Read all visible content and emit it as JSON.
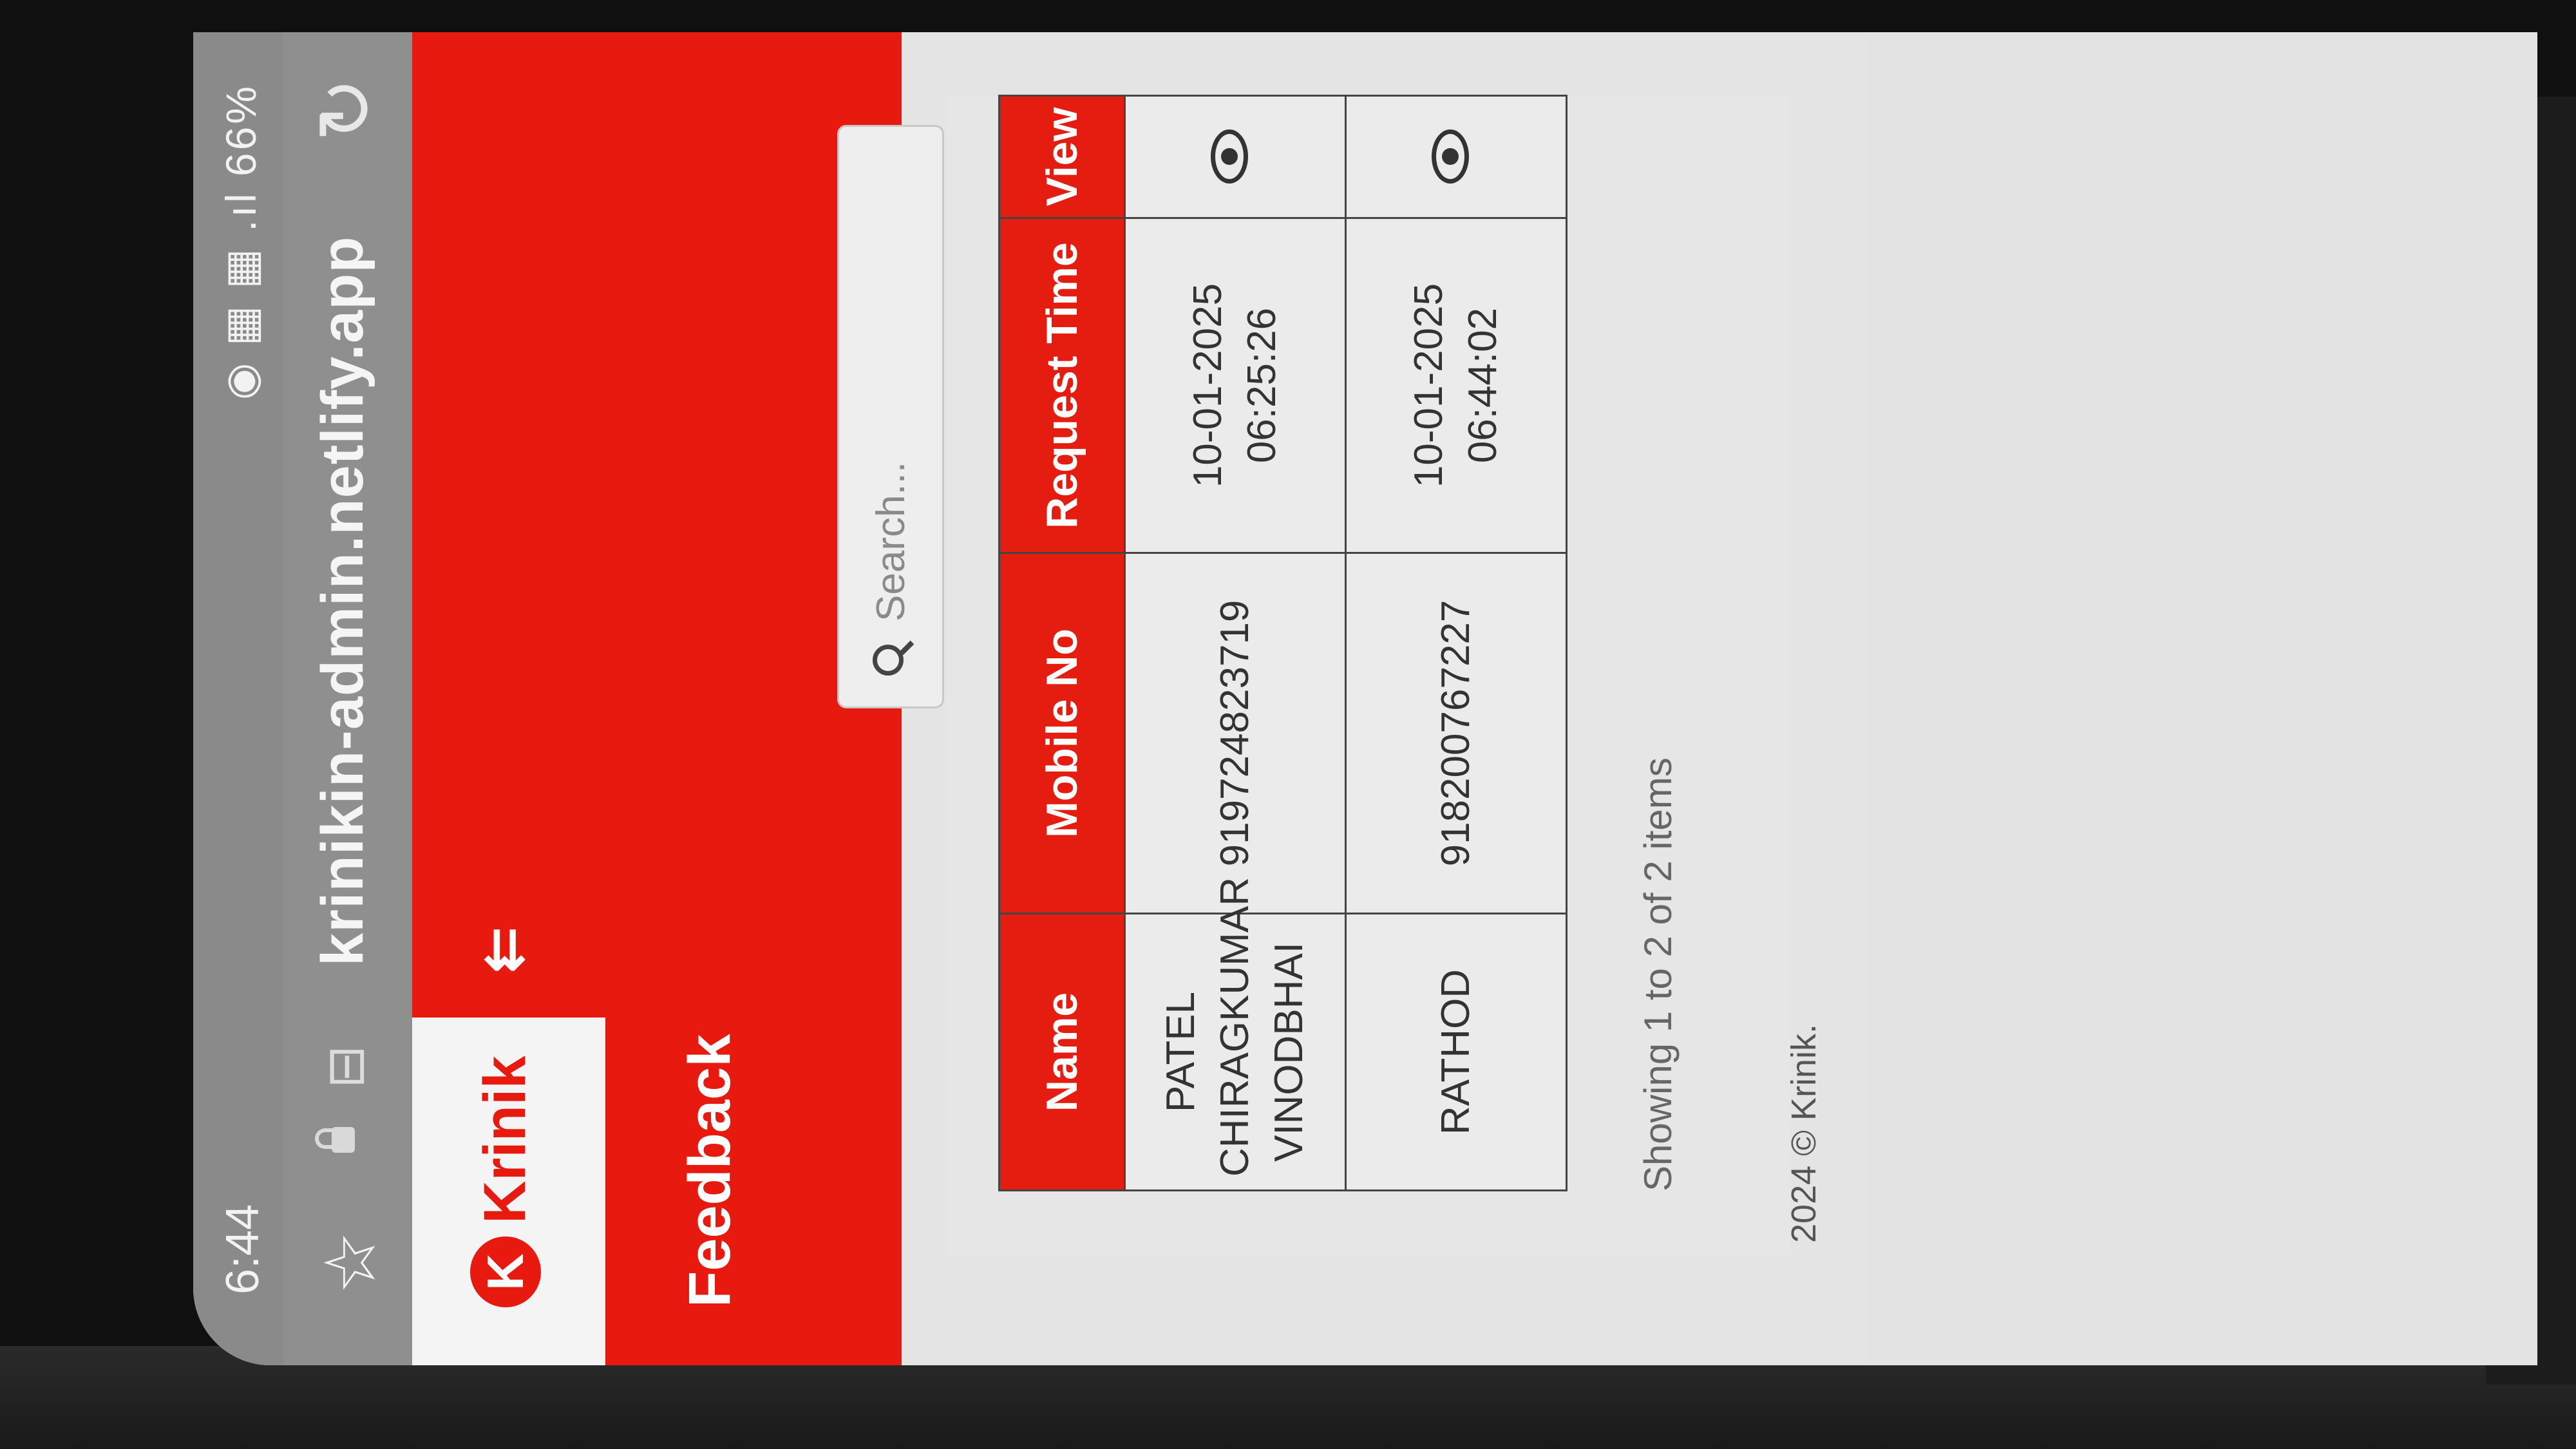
{
  "status_bar": {
    "time": "6:44",
    "icons": "◉ ▦ ▦ .ıl",
    "battery": "66%"
  },
  "browser": {
    "url": "krinikin-admin.netlify.app",
    "star_icon": "☆",
    "tabs_icon": "⊟",
    "reload_icon": "↻"
  },
  "header": {
    "logo_text": "Krinik",
    "menu_icon": "⇇"
  },
  "page": {
    "title": "Feedback"
  },
  "search": {
    "placeholder": "Search..."
  },
  "table": {
    "columns": [
      "Name",
      "Mobile No",
      "Request Time",
      "View"
    ],
    "rows": [
      {
        "name_line1": "PATEL",
        "name_line2": "CHIRAGKUMAR",
        "name_line3": "VINODBHAI",
        "mobile": "919724823719",
        "time_date": "10-01-2025",
        "time_clock": "06:25:26"
      },
      {
        "name_line1": "RATHOD",
        "mobile": "918200767227",
        "time_date": "10-01-2025",
        "time_clock": "06:44:02"
      }
    ]
  },
  "pagination": {
    "info": "Showing 1 to 2 of 2 items"
  },
  "footer": {
    "text": "2024 © Krinik."
  },
  "colors": {
    "brand_red": "#e8190f",
    "page_bg": "#e4e4e4"
  }
}
